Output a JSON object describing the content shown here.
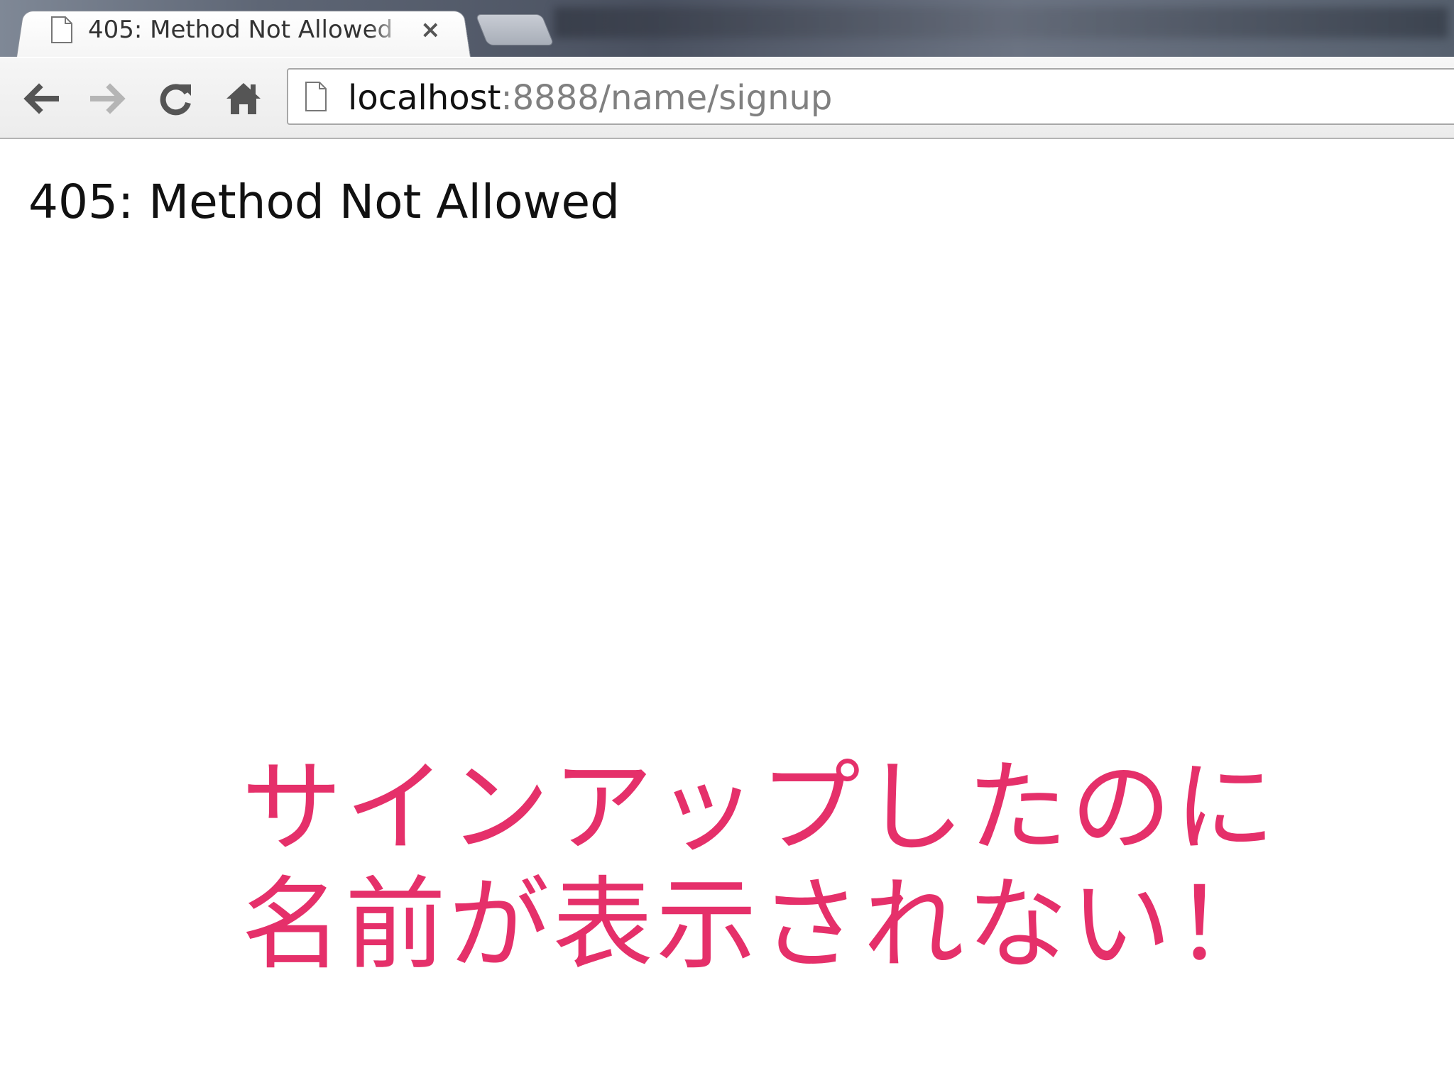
{
  "browser": {
    "tab": {
      "title": "405: Method Not Allowed",
      "close_glyph": "×",
      "icon": "page-icon"
    },
    "toolbar": {
      "back_icon": "back-arrow-icon",
      "forward_icon": "forward-arrow-icon",
      "reload_icon": "reload-icon",
      "home_icon": "home-icon"
    },
    "omnibox": {
      "host": "localhost",
      "path": ":8888/name/signup",
      "icon": "page-icon"
    }
  },
  "page": {
    "error_text": "405: Method Not Allowed"
  },
  "caption": {
    "line1": "サインアップしたのに",
    "line2": "名前が表示されない！",
    "color": "#e5306a"
  }
}
